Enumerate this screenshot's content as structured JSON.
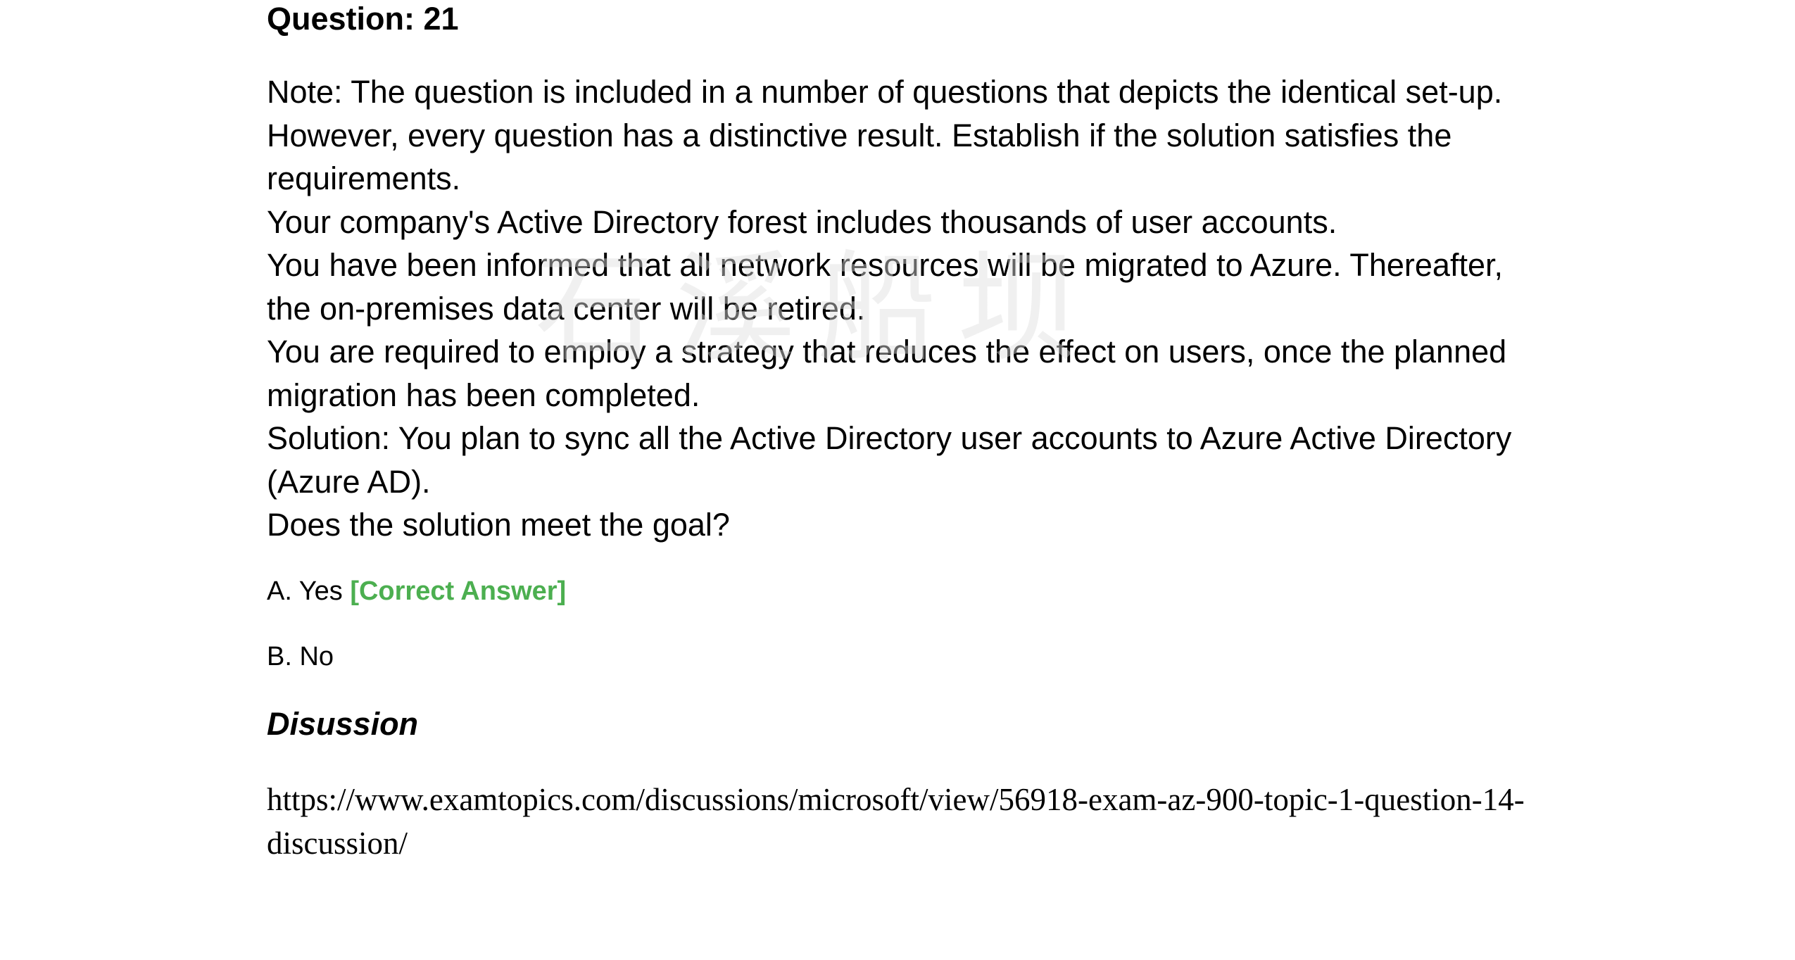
{
  "question": {
    "title": "Question: 21",
    "paragraphs": [
      "Note: The question is included in a number of questions that depicts the identical set-up. However, every question has a distinctive result. Establish if the solution satisfies the requirements.",
      "Your company's Active Directory forest includes thousands of user accounts.",
      "You have been informed that all network resources will be migrated to Azure. Thereafter, the on-premises data center will be retired.",
      "You are required to employ a strategy that reduces the effect on users, once the planned migration has been completed.",
      "Solution: You plan to sync all the Active Directory user accounts to Azure Active Directory (Azure AD).",
      "Does the solution meet the goal?"
    ]
  },
  "options": [
    {
      "label": "A. Yes ",
      "tag": "[Correct Answer]"
    },
    {
      "label": "B. No"
    }
  ],
  "discussion": {
    "title": "Disussion",
    "link": "https://www.examtopics.com/discussions/microsoft/view/56918-exam-az-900-topic-1-question-14-discussion/"
  },
  "colors": {
    "correct_answer": "#4caf50"
  }
}
